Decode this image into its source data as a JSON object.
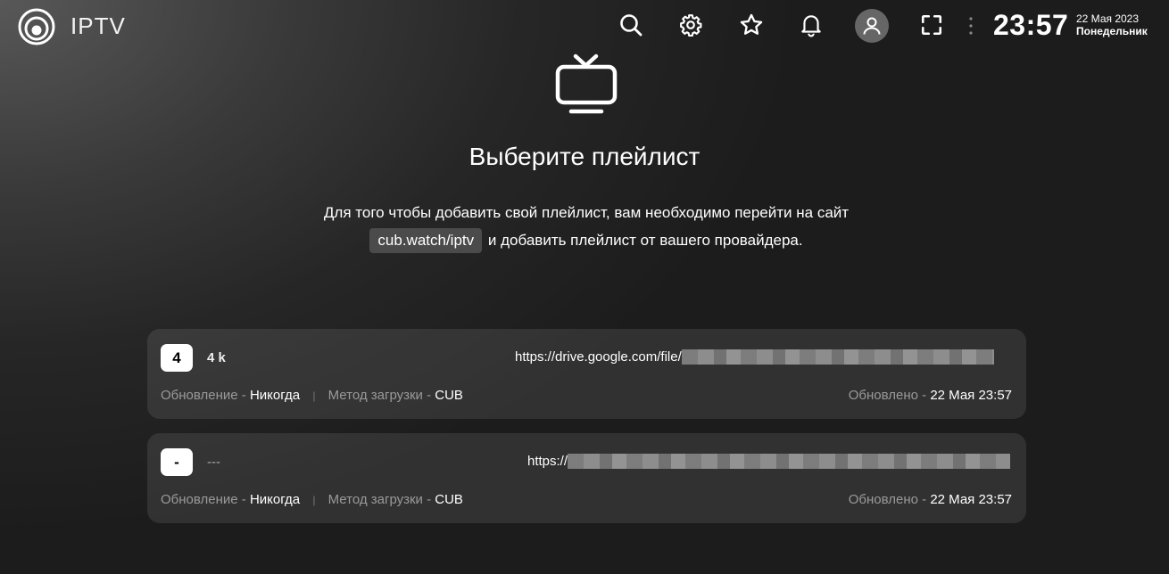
{
  "header": {
    "app_title": "IPTV",
    "icons": [
      "search-icon",
      "settings-icon",
      "star-icon",
      "bell-icon",
      "user-icon",
      "fullscreen-icon",
      "more-vertical-icon"
    ],
    "time": "23:57",
    "date": "22 Мая 2023",
    "weekday": "Понедельник"
  },
  "main": {
    "icon": "tv-icon",
    "title": "Выберите плейлист",
    "desc_line1": "Для того чтобы добавить свой плейлист, вам необходимо перейти на сайт",
    "desc_code": "cub.watch/iptv",
    "desc_line2": "и добавить плейлист от вашего провайдера."
  },
  "playlists": [
    {
      "number": "4",
      "name": "4 k",
      "url": "https://drive.google.com/file/",
      "update_label": "Обновление - ",
      "update_value": "Никогда",
      "method_label": "Метод загрузки - ",
      "method_value": "CUB",
      "updated_label": "Обновлено - ",
      "updated_value": "22 Мая 23:57"
    },
    {
      "number": "-",
      "name": "---",
      "url": "https://",
      "update_label": "Обновление - ",
      "update_value": "Никогда",
      "method_label": "Метод загрузки - ",
      "method_value": "CUB",
      "updated_label": "Обновлено - ",
      "updated_value": "22 Мая 23:57"
    }
  ],
  "colors": {
    "background": "#2a2a2a",
    "card": "#3a3a3a",
    "accent_text": "#ffffff",
    "muted_text": "#9a9a9a"
  }
}
